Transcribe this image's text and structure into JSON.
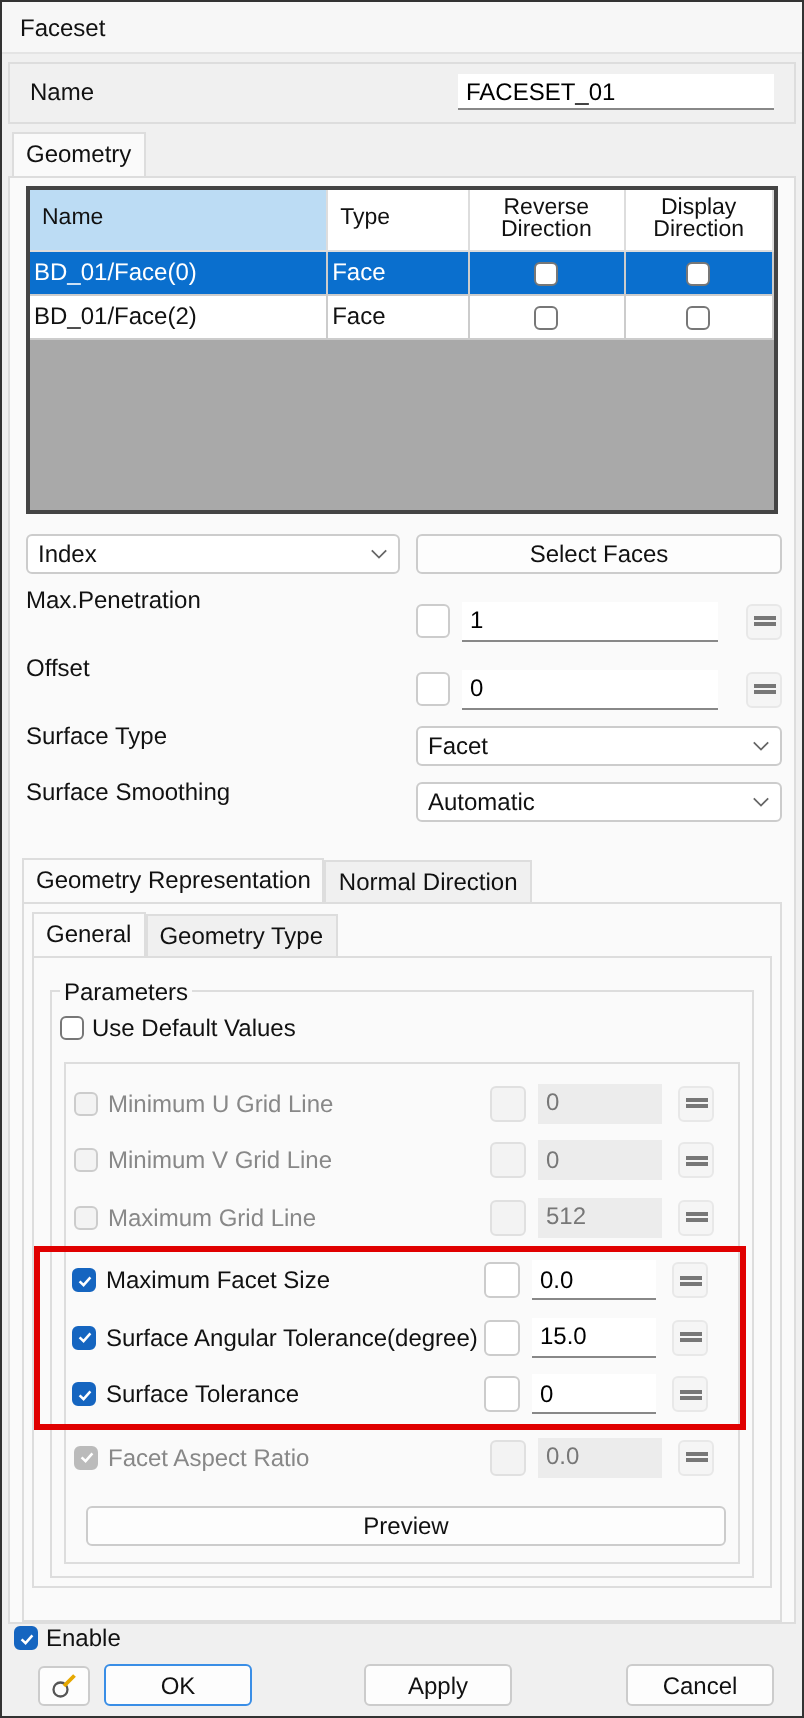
{
  "window": {
    "title": "Faceset"
  },
  "name_field": {
    "label": "Name",
    "value": "FACESET_01"
  },
  "tabs": [
    {
      "label": "Geometry",
      "selected": true
    }
  ],
  "table": {
    "columns": [
      {
        "label": "Name",
        "selected": true
      },
      {
        "label": "Type",
        "selected": false
      },
      {
        "label": "Reverse Direction",
        "selected": false
      },
      {
        "label": "Display Direction",
        "selected": false
      }
    ],
    "rows": [
      {
        "name": "BD_01/Face(0)",
        "type": "Face",
        "reverse": false,
        "display": false,
        "selected": true
      },
      {
        "name": "BD_01/Face(2)",
        "type": "Face",
        "reverse": false,
        "display": false,
        "selected": false
      }
    ]
  },
  "selection": {
    "mode": "Index",
    "button": "Select Faces"
  },
  "fields": [
    {
      "label": "Max.Penetration",
      "kind": "number",
      "value": "1",
      "checked": false
    },
    {
      "label": "Offset",
      "kind": "number",
      "value": "0",
      "checked": false
    },
    {
      "label": "Surface Type",
      "kind": "dropdown",
      "value": "Facet"
    },
    {
      "label": "Surface Smoothing",
      "kind": "dropdown",
      "value": "Automatic"
    }
  ],
  "outer_tabs": [
    {
      "label": "Geometry Representation",
      "selected": true
    },
    {
      "label": "Normal Direction",
      "selected": false
    }
  ],
  "inner_tabs": [
    {
      "label": "General",
      "selected": true
    },
    {
      "label": "Geometry Type",
      "selected": false
    }
  ],
  "parameters": {
    "title": "Parameters",
    "use_default": {
      "label": "Use Default Values",
      "checked": false
    },
    "rows": [
      {
        "label": "Minimum U Grid Line",
        "value": "0",
        "checked": false,
        "disabled": true,
        "highlighted": false
      },
      {
        "label": "Minimum V Grid Line",
        "value": "0",
        "checked": false,
        "disabled": true,
        "highlighted": false
      },
      {
        "label": "Maximum Grid Line",
        "value": "512",
        "checked": false,
        "disabled": true,
        "highlighted": false
      },
      {
        "label": "Maximum Facet Size",
        "value": "0.0",
        "checked": true,
        "disabled": false,
        "highlighted": true
      },
      {
        "label": "Surface Angular Tolerance(degree)",
        "value": "15.0",
        "checked": true,
        "disabled": false,
        "highlighted": true
      },
      {
        "label": "Surface Tolerance",
        "value": "0",
        "checked": true,
        "disabled": false,
        "highlighted": true
      },
      {
        "label": "Facet Aspect Ratio",
        "value": "0.0",
        "checked": true,
        "disabled": true,
        "highlighted": false
      }
    ],
    "preview": "Preview"
  },
  "enable": {
    "label": "Enable",
    "checked": true
  },
  "buttons": [
    {
      "label": "OK",
      "default": true
    },
    {
      "label": "Apply",
      "default": false
    },
    {
      "label": "Cancel",
      "default": false
    }
  ]
}
